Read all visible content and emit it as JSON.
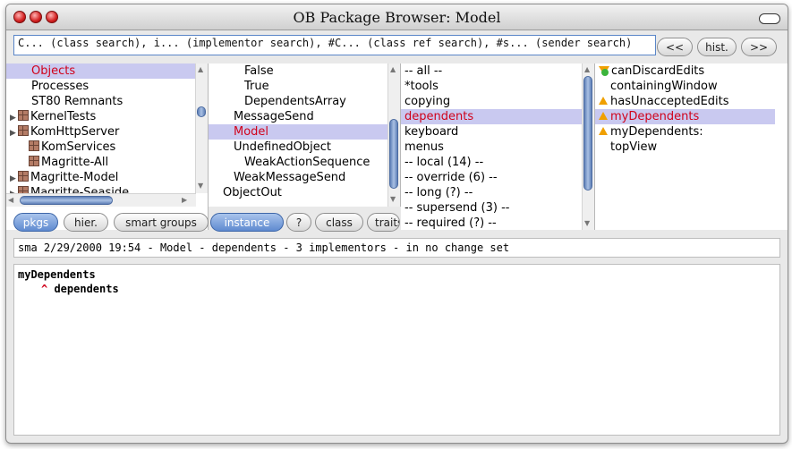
{
  "window": {
    "title": "OB Package Browser: Model"
  },
  "search": {
    "value": "C... (class search), i... (implementor search), #C... (class ref search), #s... (sender search)"
  },
  "nav": {
    "back": "<<",
    "hist": "hist.",
    "forward": ">>"
  },
  "packages": {
    "items": [
      {
        "label": "Objects",
        "selected": true,
        "indent": 2,
        "icon": "none"
      },
      {
        "label": "Processes",
        "indent": 2,
        "icon": "none"
      },
      {
        "label": "ST80 Remnants",
        "indent": 2,
        "icon": "none"
      },
      {
        "label": "KernelTests",
        "indent": 0,
        "icon": "package-icon",
        "expandable": true
      },
      {
        "label": "KomHttpServer",
        "indent": 0,
        "icon": "package-icon",
        "expandable": true
      },
      {
        "label": "KomServices",
        "indent": 1,
        "icon": "package-icon"
      },
      {
        "label": "Magritte-All",
        "indent": 1,
        "icon": "package-icon"
      },
      {
        "label": "Magritte-Model",
        "indent": 0,
        "icon": "package-icon",
        "expandable": true
      },
      {
        "label": "Magritte-Seaside",
        "indent": 0,
        "icon": "package-icon",
        "expandable": true
      }
    ]
  },
  "classes": {
    "items": [
      {
        "label": "False",
        "indent": 3
      },
      {
        "label": "True",
        "indent": 3
      },
      {
        "label": "DependentsArray",
        "indent": 3
      },
      {
        "label": "MessageSend",
        "indent": 2
      },
      {
        "label": "Model",
        "indent": 2,
        "selected": true
      },
      {
        "label": "UndefinedObject",
        "indent": 2
      },
      {
        "label": "WeakActionSequence",
        "indent": 3
      },
      {
        "label": "WeakMessageSend",
        "indent": 2
      },
      {
        "label": "ObjectOut",
        "indent": 1
      }
    ]
  },
  "categories": {
    "items": [
      {
        "label": "-- all --"
      },
      {
        "label": "*tools"
      },
      {
        "label": "copying"
      },
      {
        "label": "dependents",
        "selected": true
      },
      {
        "label": "keyboard"
      },
      {
        "label": "menus"
      },
      {
        "label": "-- local (14) --"
      },
      {
        "label": "-- override (6) --"
      },
      {
        "label": "-- long (?) --"
      },
      {
        "label": "-- supersend (3) --"
      },
      {
        "label": "-- required (?) --"
      }
    ]
  },
  "methods": {
    "items": [
      {
        "label": "canDiscardEdits",
        "icon": "override-icon"
      },
      {
        "label": "containingWindow",
        "icon": "none"
      },
      {
        "label": "hasUnacceptedEdits",
        "icon": "warning-icon"
      },
      {
        "label": "myDependents",
        "icon": "warning-icon",
        "selected": true
      },
      {
        "label": "myDependents:",
        "icon": "warning-icon"
      },
      {
        "label": "topView",
        "icon": "none"
      }
    ]
  },
  "toolbar": {
    "pkgs": "pkgs",
    "hier": "hier.",
    "smart_groups": "smart groups",
    "instance": "instance",
    "help": "?",
    "class": "class",
    "traits": "traits"
  },
  "info": {
    "text": "sma 2/29/2000 19:54 - Model - dependents - 3 implementors - in no change set"
  },
  "code": {
    "line1": "myDependents",
    "line2": "^ dependents"
  },
  "colors": {
    "selection": "#c9c9f0",
    "selected_text": "#d0021b",
    "button_active": "#5f8ad0"
  }
}
